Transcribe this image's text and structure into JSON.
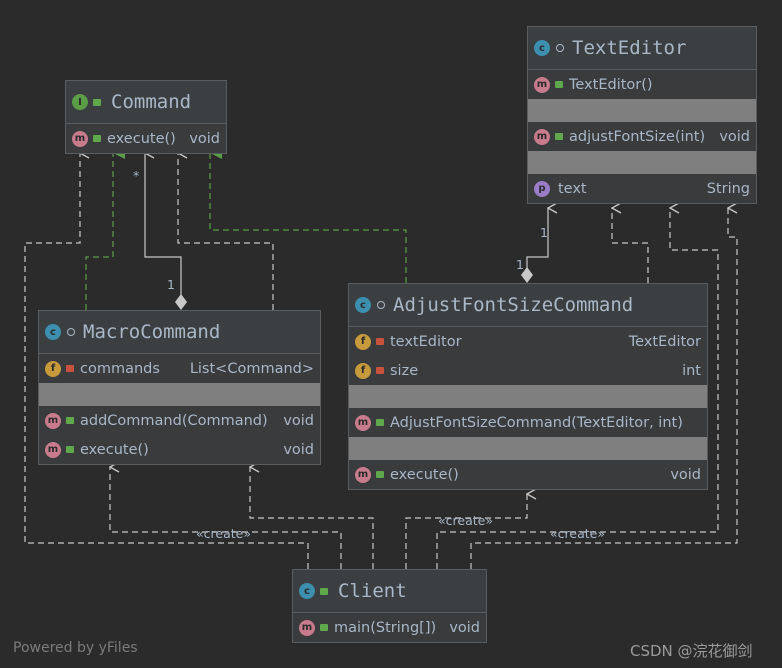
{
  "classes": {
    "command": {
      "name": "Command",
      "kind": "interface",
      "members": [
        {
          "name": "execute()",
          "type": "void"
        }
      ]
    },
    "text_editor": {
      "name": "TextEditor",
      "kind": "class",
      "ctor": "TextEditor()",
      "method": {
        "name": "adjustFontSize(int)",
        "type": "void"
      },
      "field": {
        "name": "text",
        "type": "String"
      }
    },
    "macro": {
      "name": "MacroCommand",
      "kind": "class",
      "field": {
        "name": "commands",
        "type": "List<Command>"
      },
      "methods": [
        {
          "name": "addCommand(Command)",
          "type": "void"
        },
        {
          "name": "execute()",
          "type": "void"
        }
      ]
    },
    "adjust": {
      "name": "AdjustFontSizeCommand",
      "kind": "class",
      "fields": [
        {
          "name": "textEditor",
          "type": "TextEditor"
        },
        {
          "name": "size",
          "type": "int"
        }
      ],
      "ctor": "AdjustFontSizeCommand(TextEditor, int)",
      "method": {
        "name": "execute()",
        "type": "void"
      }
    },
    "client": {
      "name": "Client",
      "kind": "class",
      "method": {
        "name": "main(String[])",
        "type": "void"
      }
    }
  },
  "labels": {
    "create1": "«create»",
    "create2": "«create»",
    "create3": "«create»",
    "mult_star": "*",
    "mult_1a": "1",
    "mult_1b": "1",
    "mult_1c": "1"
  },
  "icons": {
    "c": "c",
    "i": "I",
    "m": "m",
    "f": "f",
    "p": "p"
  },
  "footer": {
    "left": "Powered by yFiles",
    "right": "CSDN @浣花御剑"
  },
  "colors": {
    "background": "#2b2b2b",
    "realization": "#5a9e47",
    "edge": "#c8c8c8"
  }
}
